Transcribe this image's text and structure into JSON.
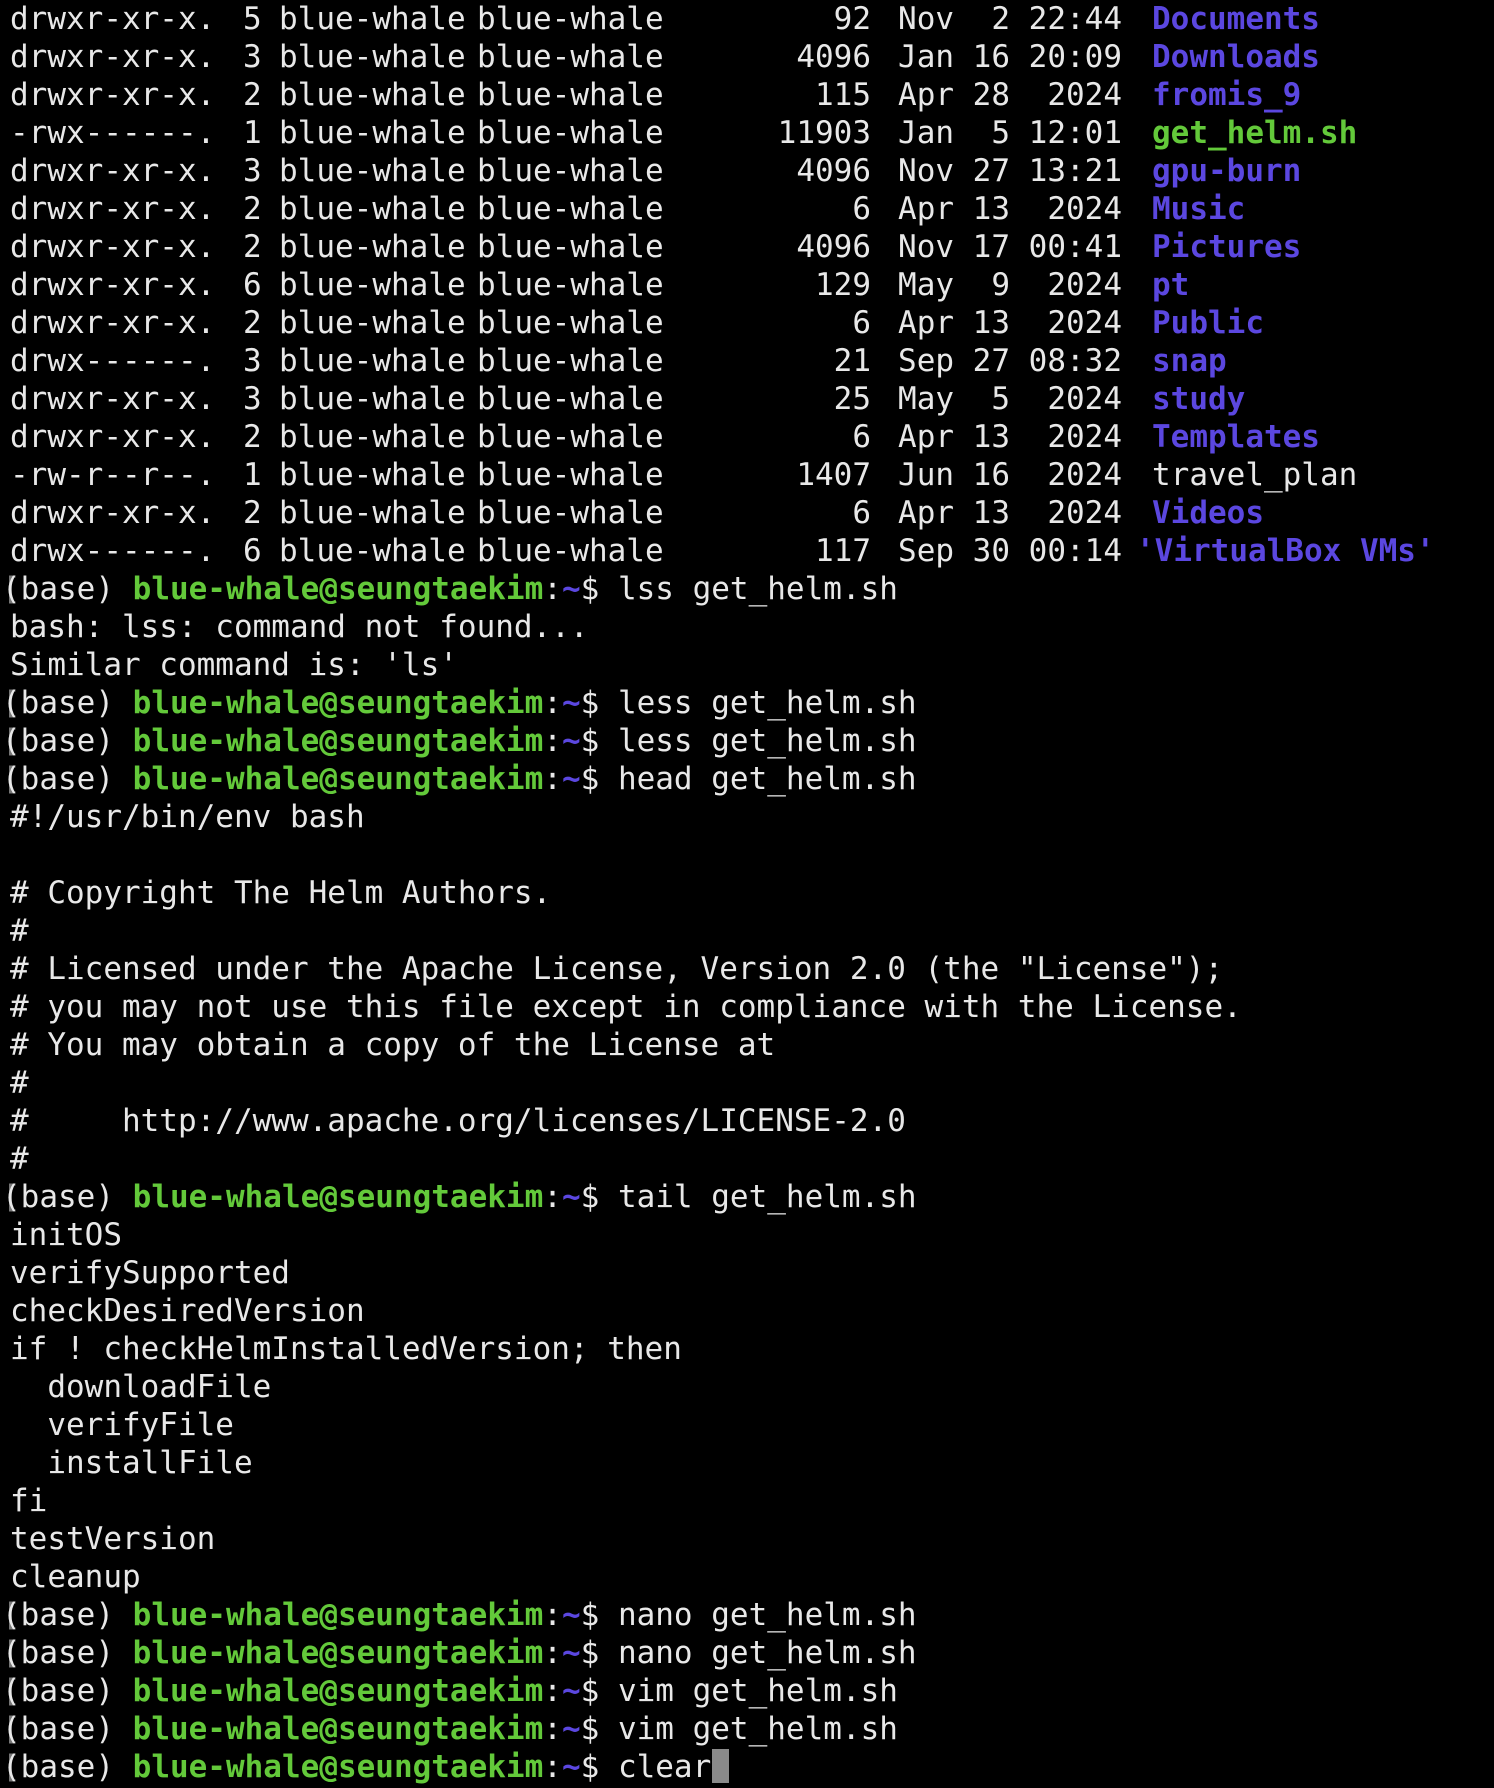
{
  "colors": {
    "background": "#000000",
    "foreground": "#e8e8e8",
    "directory": "#5b47e0",
    "executable": "#63c93a",
    "prompt_user": "#63c93a",
    "prompt_path": "#5b47e0",
    "cursor": "#8a8a8a"
  },
  "listing": [
    {
      "perm": "drwxr-xr-x.",
      "links": "5",
      "owner": "blue-whale",
      "group": "blue-whale",
      "size": "92",
      "date": "Nov  2 22:44",
      "name": "Documents",
      "kind": "dir"
    },
    {
      "perm": "drwxr-xr-x.",
      "links": "3",
      "owner": "blue-whale",
      "group": "blue-whale",
      "size": "4096",
      "date": "Jan 16 20:09",
      "name": "Downloads",
      "kind": "dir"
    },
    {
      "perm": "drwxr-xr-x.",
      "links": "2",
      "owner": "blue-whale",
      "group": "blue-whale",
      "size": "115",
      "date": "Apr 28  2024",
      "name": "fromis_9",
      "kind": "dir"
    },
    {
      "perm": "-rwx------.",
      "links": "1",
      "owner": "blue-whale",
      "group": "blue-whale",
      "size": "11903",
      "date": "Jan  5 12:01",
      "name": "get_helm.sh",
      "kind": "exec"
    },
    {
      "perm": "drwxr-xr-x.",
      "links": "3",
      "owner": "blue-whale",
      "group": "blue-whale",
      "size": "4096",
      "date": "Nov 27 13:21",
      "name": "gpu-burn",
      "kind": "dir"
    },
    {
      "perm": "drwxr-xr-x.",
      "links": "2",
      "owner": "blue-whale",
      "group": "blue-whale",
      "size": "6",
      "date": "Apr 13  2024",
      "name": "Music",
      "kind": "dir"
    },
    {
      "perm": "drwxr-xr-x.",
      "links": "2",
      "owner": "blue-whale",
      "group": "blue-whale",
      "size": "4096",
      "date": "Nov 17 00:41",
      "name": "Pictures",
      "kind": "dir"
    },
    {
      "perm": "drwxr-xr-x.",
      "links": "6",
      "owner": "blue-whale",
      "group": "blue-whale",
      "size": "129",
      "date": "May  9  2024",
      "name": "pt",
      "kind": "dir"
    },
    {
      "perm": "drwxr-xr-x.",
      "links": "2",
      "owner": "blue-whale",
      "group": "blue-whale",
      "size": "6",
      "date": "Apr 13  2024",
      "name": "Public",
      "kind": "dir"
    },
    {
      "perm": "drwx------.",
      "links": "3",
      "owner": "blue-whale",
      "group": "blue-whale",
      "size": "21",
      "date": "Sep 27 08:32",
      "name": "snap",
      "kind": "dir"
    },
    {
      "perm": "drwxr-xr-x.",
      "links": "3",
      "owner": "blue-whale",
      "group": "blue-whale",
      "size": "25",
      "date": "May  5  2024",
      "name": "study",
      "kind": "dir"
    },
    {
      "perm": "drwxr-xr-x.",
      "links": "2",
      "owner": "blue-whale",
      "group": "blue-whale",
      "size": "6",
      "date": "Apr 13  2024",
      "name": "Templates",
      "kind": "dir"
    },
    {
      "perm": "-rw-r--r--.",
      "links": "1",
      "owner": "blue-whale",
      "group": "blue-whale",
      "size": "1407",
      "date": "Jun 16  2024",
      "name": "travel_plan",
      "kind": "file"
    },
    {
      "perm": "drwxr-xr-x.",
      "links": "2",
      "owner": "blue-whale",
      "group": "blue-whale",
      "size": "6",
      "date": "Apr 13  2024",
      "name": "Videos",
      "kind": "dir"
    },
    {
      "perm": "drwx------.",
      "links": "6",
      "owner": "blue-whale",
      "group": "blue-whale",
      "size": "117",
      "date": "Sep 30 00:14",
      "name": "'VirtualBox VMs'",
      "kind": "dir",
      "quoted": true
    }
  ],
  "prompt": {
    "env": "(base) ",
    "user_host": "blue-whale@seungtaekim",
    "colon": ":",
    "path": "~",
    "dollar": "$ "
  },
  "session": [
    {
      "type": "prompt",
      "cmd": "lss get_helm.sh"
    },
    {
      "type": "out",
      "text": "bash: lss: command not found..."
    },
    {
      "type": "out",
      "text": "Similar command is: 'ls'"
    },
    {
      "type": "prompt",
      "cmd": "less get_helm.sh"
    },
    {
      "type": "prompt",
      "cmd": "less get_helm.sh"
    },
    {
      "type": "prompt",
      "cmd": "head get_helm.sh"
    },
    {
      "type": "out",
      "text": "#!/usr/bin/env bash"
    },
    {
      "type": "out",
      "text": ""
    },
    {
      "type": "out",
      "text": "# Copyright The Helm Authors."
    },
    {
      "type": "out",
      "text": "#"
    },
    {
      "type": "out",
      "text": "# Licensed under the Apache License, Version 2.0 (the \"License\");"
    },
    {
      "type": "out",
      "text": "# you may not use this file except in compliance with the License."
    },
    {
      "type": "out",
      "text": "# You may obtain a copy of the License at"
    },
    {
      "type": "out",
      "text": "#"
    },
    {
      "type": "out",
      "text": "#     http://www.apache.org/licenses/LICENSE-2.0"
    },
    {
      "type": "out",
      "text": "#"
    },
    {
      "type": "prompt",
      "cmd": "tail get_helm.sh"
    },
    {
      "type": "out",
      "text": "initOS"
    },
    {
      "type": "out",
      "text": "verifySupported"
    },
    {
      "type": "out",
      "text": "checkDesiredVersion"
    },
    {
      "type": "out",
      "text": "if ! checkHelmInstalledVersion; then"
    },
    {
      "type": "out",
      "text": "  downloadFile"
    },
    {
      "type": "out",
      "text": "  verifyFile"
    },
    {
      "type": "out",
      "text": "  installFile"
    },
    {
      "type": "out",
      "text": "fi"
    },
    {
      "type": "out",
      "text": "testVersion"
    },
    {
      "type": "out",
      "text": "cleanup"
    },
    {
      "type": "prompt",
      "cmd": "nano get_helm.sh"
    },
    {
      "type": "prompt",
      "cmd": "nano get_helm.sh"
    },
    {
      "type": "prompt",
      "cmd": "vim get_helm.sh"
    },
    {
      "type": "prompt",
      "cmd": "vim get_helm.sh"
    },
    {
      "type": "prompt",
      "cmd": "clear",
      "active": true
    }
  ]
}
